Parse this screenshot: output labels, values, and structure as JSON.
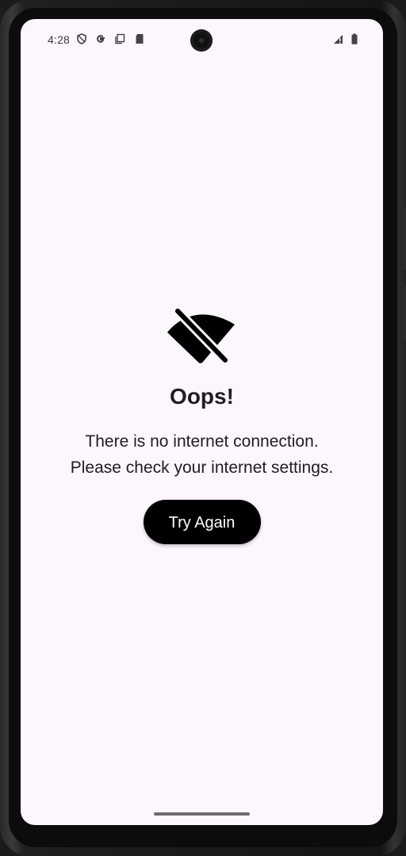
{
  "status_bar": {
    "time": "4:28",
    "icons": [
      "shield-icon",
      "google-icon",
      "copy-icon",
      "sd-card-icon",
      "signal-icon",
      "battery-icon"
    ]
  },
  "error": {
    "icon": "wifi-off-icon",
    "title": "Oops!",
    "message_line1": "There is no internet connection.",
    "message_line2": "Please check your internet settings.",
    "retry_label": "Try Again"
  },
  "colors": {
    "background": "#fcf6fd",
    "button": "#000000",
    "button_text": "#ffffff",
    "text": "#1f1d22"
  }
}
